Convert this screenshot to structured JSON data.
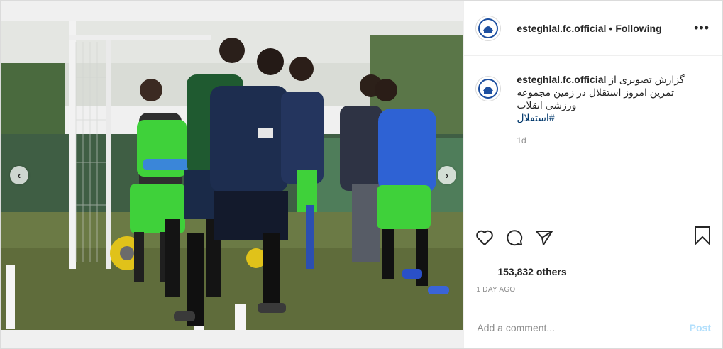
{
  "header": {
    "username": "esteghlal.fc.official",
    "separator": "•",
    "follow_status": "Following",
    "more_label": "•••"
  },
  "caption": {
    "username": "esteghlal.fc.official",
    "text": "گزارش تصویری از تمرین امروز استقلال در زمین مجموعه ورزشی انقلاب",
    "hashtag": "#استقلال",
    "time": "1d"
  },
  "stats": {
    "likes": "153,832 others",
    "posted_ago": "1 DAY AGO"
  },
  "comment_box": {
    "placeholder": "Add a comment...",
    "post_label": "Post"
  },
  "carousel": {
    "prev_label": "‹",
    "next_label": "›"
  },
  "colors": {
    "brand_blue": "#1d4fa0",
    "link": "#00376b",
    "muted": "#8e8e8e",
    "post_disabled": "#b2dffc"
  },
  "icons": {
    "like": "heart-icon",
    "comment": "comment-icon",
    "share": "paper-plane-icon",
    "save": "bookmark-icon"
  }
}
